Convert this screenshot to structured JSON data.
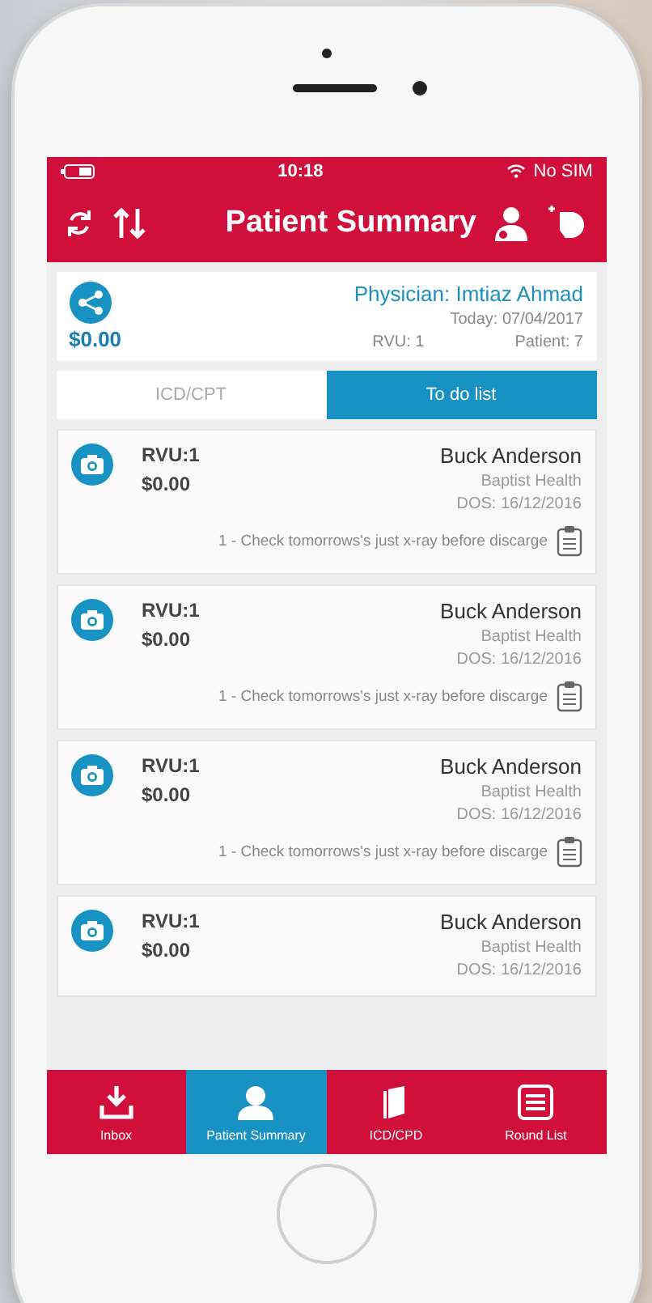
{
  "status_bar": {
    "carrier": "No SIM",
    "time": "10:18"
  },
  "header": {
    "title": "Patient Summary"
  },
  "summary": {
    "physician": "Physician: Imtiaz Ahmad",
    "today": "Today: 07/04/2017",
    "patient": "Patient: 7",
    "rvu": "RVU: 1",
    "amount": "$0.00"
  },
  "tabs": [
    {
      "label": "ICD/CPT",
      "selected": false
    },
    {
      "label": "To do list",
      "selected": true
    }
  ],
  "patients": [
    {
      "name": "Buck Anderson",
      "facility": "Baptist Health",
      "dos": "DOS: 16/12/2016",
      "rvu": "RVU:1",
      "amount": "$0.00",
      "note": "1 - Check tomorrows's just x-ray before discarge"
    },
    {
      "name": "Buck Anderson",
      "facility": "Baptist Health",
      "dos": "DOS: 16/12/2016",
      "rvu": "RVU:1",
      "amount": "$0.00",
      "note": "1 - Check tomorrows's just x-ray before discarge"
    },
    {
      "name": "Buck Anderson",
      "facility": "Baptist Health",
      "dos": "DOS: 16/12/2016",
      "rvu": "RVU:1",
      "amount": "$0.00",
      "note": "1 - Check tomorrows's just x-ray before discarge"
    },
    {
      "name": "Buck Anderson",
      "facility": "Baptist Health",
      "dos": "DOS: 16/12/2016",
      "rvu": "RVU:1",
      "amount": "$0.00"
    }
  ],
  "bottom_nav": [
    {
      "kind": "inbox",
      "label": "Inbox",
      "selected": false
    },
    {
      "kind": "person",
      "label": "Patient Summary",
      "selected": true
    },
    {
      "kind": "book",
      "label": "ICD/CPD",
      "selected": false
    },
    {
      "kind": "list",
      "label": "Round List",
      "selected": false
    }
  ]
}
